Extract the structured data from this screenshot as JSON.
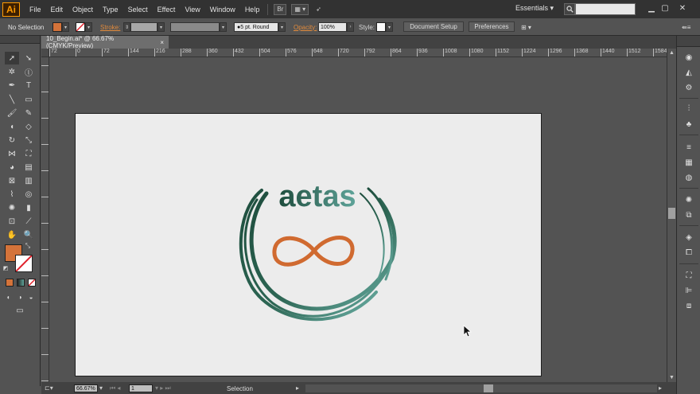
{
  "app": {
    "logo_text": "Ai",
    "menu": [
      "File",
      "Edit",
      "Object",
      "Type",
      "Select",
      "Effect",
      "View",
      "Window",
      "Help"
    ],
    "bridge_label": "Br",
    "workspace": "Essentials",
    "search_placeholder": ""
  },
  "controlbar": {
    "selection": "No Selection",
    "stroke_label": "Stroke:",
    "brush": "5 pt. Round",
    "opacity_label": "Opacity:",
    "opacity_value": "100%",
    "style_label": "Style:",
    "document_setup": "Document Setup",
    "preferences": "Preferences",
    "fill_color": "#d4733a",
    "accent_color": "#e07b2c"
  },
  "document": {
    "tab_title": "10_Begin.ai* @ 66.67% (CMYK/Preview)",
    "close": "×"
  },
  "ruler_h": [
    "72",
    "0",
    "72",
    "144",
    "216",
    "288",
    "360",
    "432",
    "504",
    "576",
    "648",
    "720",
    "792",
    "864",
    "936",
    "1008",
    "1080",
    "1152",
    "1224",
    "1296",
    "1368",
    "1440",
    "1512",
    "1584"
  ],
  "artwork": {
    "logo_text": "aetas",
    "teal_dark": "#1e4d3d",
    "teal_light": "#5fa49a",
    "infinity_color": "#d06a30"
  },
  "status": {
    "zoom": "66.67%",
    "page": "1",
    "tool": "Selection"
  }
}
